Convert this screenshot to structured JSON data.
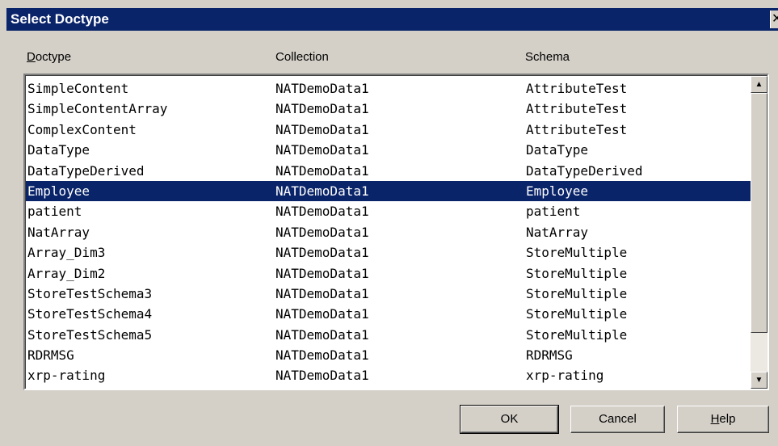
{
  "window": {
    "title": "Select Doctype",
    "close_glyph": "✕"
  },
  "columns": {
    "doctype_prefix": "D",
    "doctype_rest": "octype",
    "collection": "Collection",
    "schema": "Schema"
  },
  "rows": [
    {
      "doctype": "SimpleContent",
      "collection": "NATDemoData1",
      "schema": "AttributeTest"
    },
    {
      "doctype": "SimpleContentArray",
      "collection": "NATDemoData1",
      "schema": "AttributeTest"
    },
    {
      "doctype": "ComplexContent",
      "collection": "NATDemoData1",
      "schema": "AttributeTest"
    },
    {
      "doctype": "DataType",
      "collection": "NATDemoData1",
      "schema": "DataType"
    },
    {
      "doctype": "DataTypeDerived",
      "collection": "NATDemoData1",
      "schema": "DataTypeDerived"
    },
    {
      "doctype": "Employee",
      "collection": "NATDemoData1",
      "schema": "Employee"
    },
    {
      "doctype": "patient",
      "collection": "NATDemoData1",
      "schema": "patient"
    },
    {
      "doctype": "NatArray",
      "collection": "NATDemoData1",
      "schema": "NatArray"
    },
    {
      "doctype": "Array_Dim3",
      "collection": "NATDemoData1",
      "schema": "StoreMultiple"
    },
    {
      "doctype": "Array_Dim2",
      "collection": "NATDemoData1",
      "schema": "StoreMultiple"
    },
    {
      "doctype": "StoreTestSchema3",
      "collection": "NATDemoData1",
      "schema": "StoreMultiple"
    },
    {
      "doctype": "StoreTestSchema4",
      "collection": "NATDemoData1",
      "schema": "StoreMultiple"
    },
    {
      "doctype": "StoreTestSchema5",
      "collection": "NATDemoData1",
      "schema": "StoreMultiple"
    },
    {
      "doctype": "RDRMSG",
      "collection": "NATDemoData1",
      "schema": "RDRMSG"
    },
    {
      "doctype": "xrp-rating",
      "collection": "NATDemoData1",
      "schema": "xrp-rating"
    }
  ],
  "selected_index": 5,
  "scrollbar": {
    "up_glyph": "▲",
    "down_glyph": "▼"
  },
  "buttons": {
    "ok": "OK",
    "cancel": "Cancel",
    "help_prefix": "H",
    "help_rest": "elp"
  },
  "colors": {
    "title_bar": "#0a246a",
    "selection": "#0a246a",
    "dialog_face": "#d4d0c8"
  }
}
